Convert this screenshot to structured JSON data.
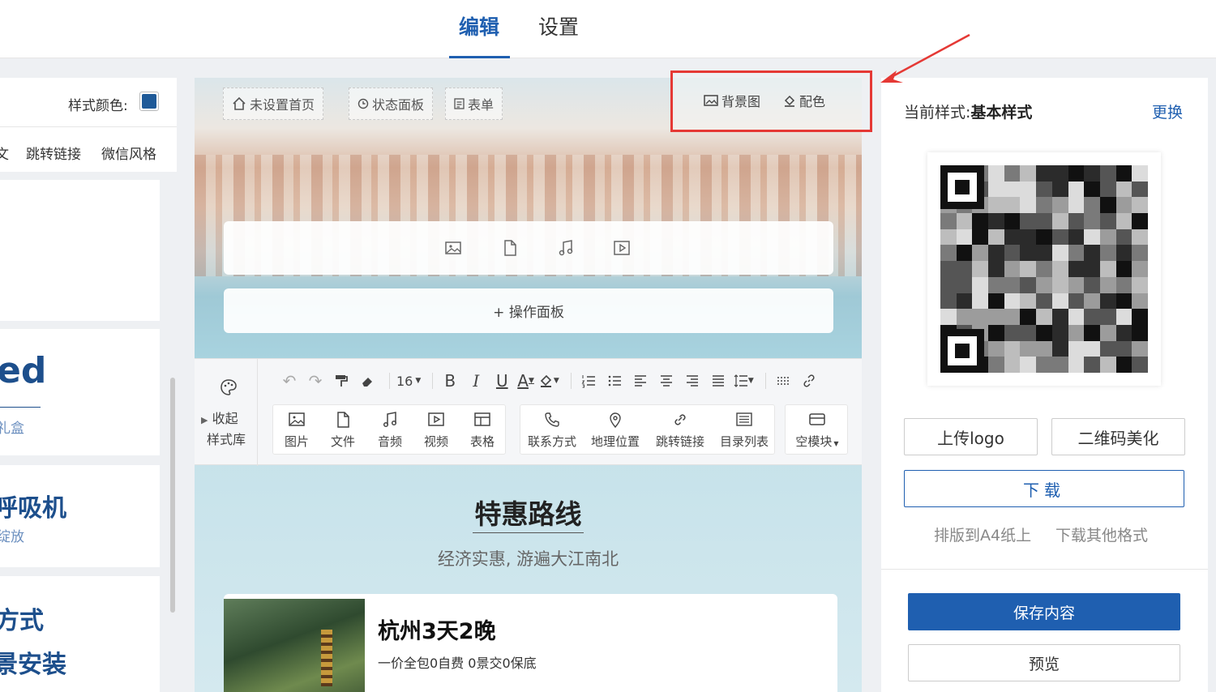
{
  "nav": {
    "tabs": [
      "编辑",
      "设置"
    ]
  },
  "left": {
    "style_color_label": "样式颜色:",
    "style_color": "#1f5a98",
    "categories": [
      "文",
      "跳转链接",
      "微信风格"
    ],
    "templates": [
      {
        "big": "ed",
        "sub": "礼盒"
      },
      {
        "big": "呼吸机",
        "sub": "绽放"
      },
      {
        "big": "方式",
        "big2": "景安装"
      }
    ]
  },
  "editor": {
    "top_pills": [
      "未设置首页",
      "状态面板",
      "表单"
    ],
    "bg_image_label": "背景图",
    "color_label": "配色",
    "media_icons": [
      "image-icon",
      "file-icon",
      "music-icon",
      "video-icon"
    ],
    "panel_label": "+ 操作面板",
    "toolbar": {
      "style_lib_expand": "收起",
      "style_lib_label": "样式库",
      "font_size": "16",
      "insert_items": [
        "图片",
        "文件",
        "音频",
        "视频",
        "表格"
      ],
      "component_items": [
        "联系方式",
        "地理位置",
        "跳转链接",
        "目录列表"
      ],
      "block_item": "空模块"
    },
    "section_title": "特惠路线",
    "section_subtitle": "经济实惠, 游遍大江南北",
    "route": {
      "title": "杭州3天2晚",
      "desc": "一价全包0自费 0景交0保底"
    }
  },
  "right": {
    "current_style_label": "当前样式:",
    "current_style_value": "基本样式",
    "change_label": "更换",
    "upload_logo": "上传logo",
    "qr_beautify": "二维码美化",
    "download": "下载",
    "print_a4": "排版到A4纸上",
    "download_other": "下载其他格式",
    "save": "保存内容",
    "preview": "预览"
  },
  "colors": {
    "accent": "#1f5fb0",
    "highlight": "#e53935"
  }
}
